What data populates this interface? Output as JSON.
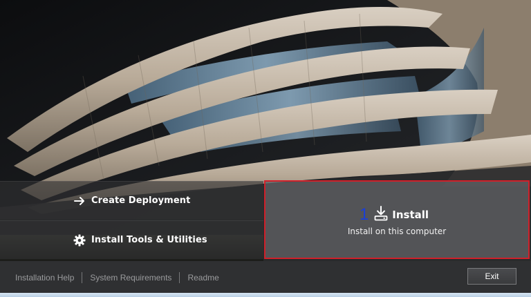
{
  "hero": {
    "image": "modern-building-facade"
  },
  "tiles": {
    "create_deployment": {
      "label": "Create Deployment",
      "icon": "arrow-right-icon"
    },
    "install_tools": {
      "label": "Install Tools & Utilities",
      "icon": "gear-icon"
    },
    "install": {
      "step_number": "1",
      "title": "Install",
      "subtitle": "Install on this computer",
      "icon": "download-icon",
      "highlight_color": "#d0202a"
    }
  },
  "footer": {
    "links": [
      "Installation Help",
      "System Requirements",
      "Readme"
    ],
    "exit_label": "Exit"
  }
}
